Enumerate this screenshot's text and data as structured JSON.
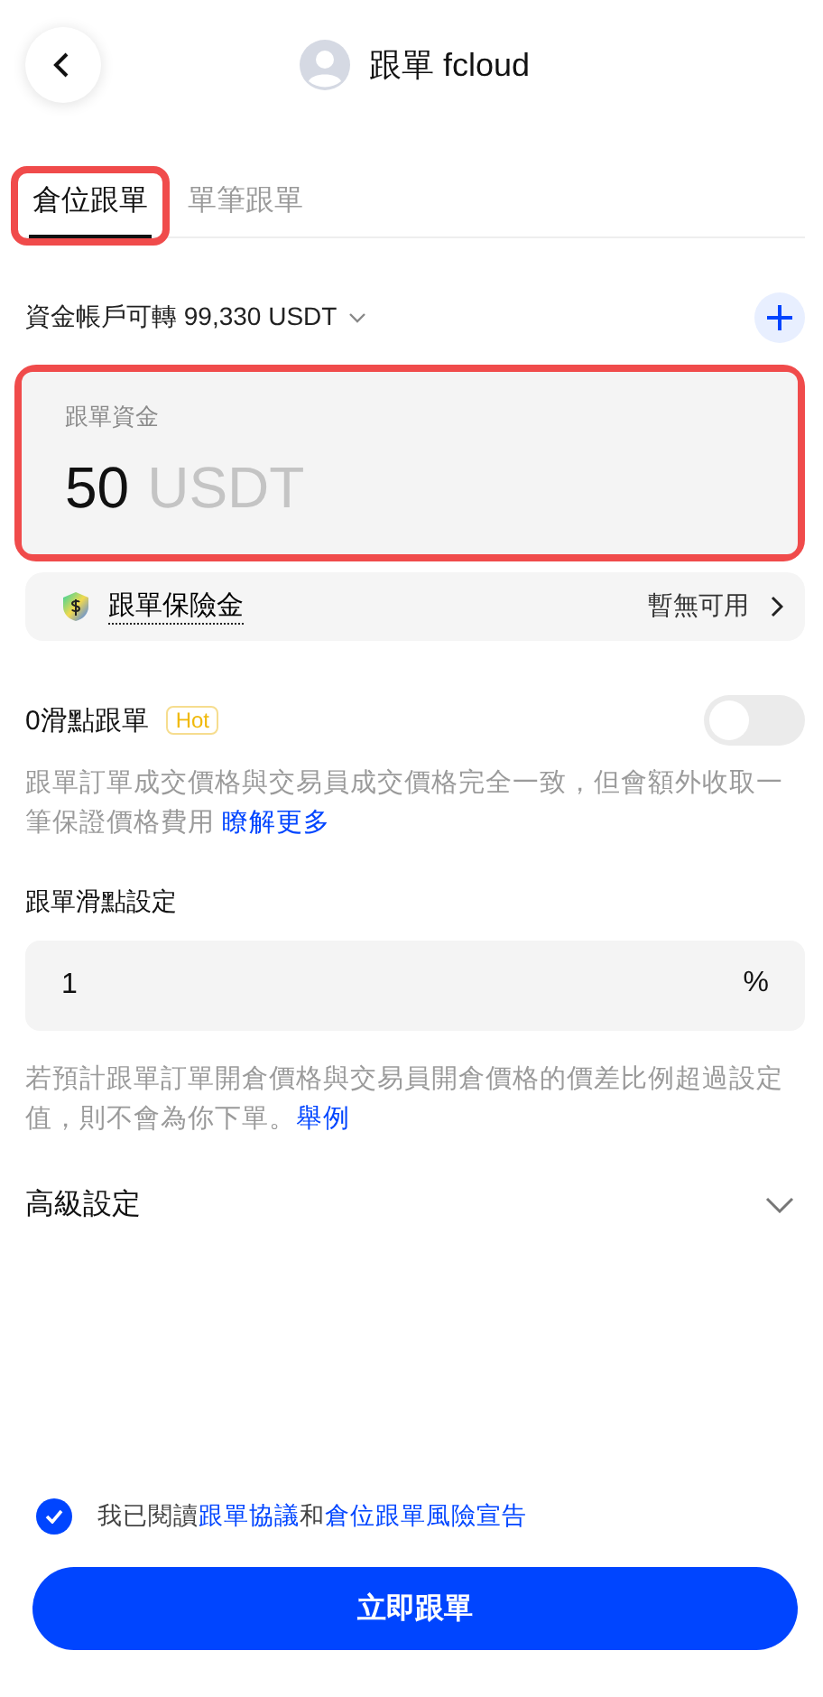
{
  "header": {
    "title": "跟單 fcloud"
  },
  "tabs": [
    {
      "label": "倉位跟單",
      "selected": true,
      "highlighted": true
    },
    {
      "label": "單筆跟單",
      "selected": false,
      "highlighted": false
    }
  ],
  "balance": {
    "text": "資金帳戶可轉 99,330 USDT"
  },
  "amount": {
    "label": "跟單資金",
    "value": "50",
    "unit": "USDT",
    "highlighted": true
  },
  "insurance": {
    "label": "跟單保險金",
    "status": "暫無可用"
  },
  "zero_slippage": {
    "label": "0滑點跟單",
    "badge": "Hot",
    "on": false,
    "description": "跟單訂單成交價格與交易員成交價格完全一致，但會額外收取一筆保證價格費用 ",
    "link": "瞭解更多"
  },
  "slippage": {
    "label": "跟單滑點設定",
    "value": "1",
    "unit": "%",
    "description": "若預計跟單訂單開倉價格與交易員開倉價格的價差比例超過設定值，則不會為你下單。",
    "link": "舉例"
  },
  "advanced": {
    "label": "高級設定",
    "expanded": false
  },
  "consent": {
    "checked": true,
    "parts": [
      {
        "text": "我已閱讀",
        "link": false
      },
      {
        "text": "跟單協議",
        "link": true
      },
      {
        "text": "和",
        "link": false
      },
      {
        "text": "倉位跟單風險宣告",
        "link": true
      }
    ]
  },
  "submit": {
    "label": "立即跟單"
  }
}
